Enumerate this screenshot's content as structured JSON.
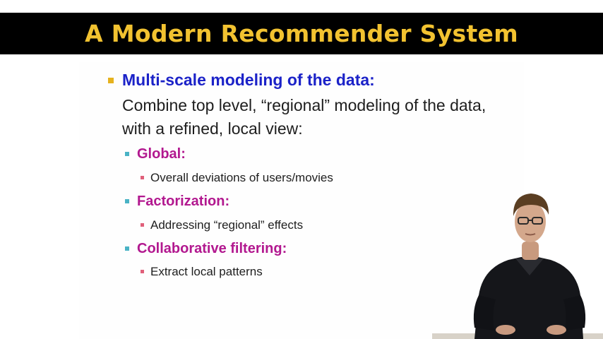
{
  "title": "A Modern Recommender System",
  "main_point": {
    "heading": "Multi-scale modeling of the data:",
    "body": "Combine top level, “regional” modeling of the data, with a refined, local view:"
  },
  "sub_points": [
    {
      "heading": "Global:",
      "detail": "Overall deviations of users/movies"
    },
    {
      "heading": "Factorization:",
      "detail": "Addressing “regional” effects"
    },
    {
      "heading": "Collaborative filtering:",
      "detail": "Extract local patterns"
    }
  ],
  "colors": {
    "title": "#f2c230",
    "heading": "#1b22c8",
    "subheading": "#b2188f",
    "bullet_main": "#e6b21e",
    "bullet_sub": "#4ab3c5",
    "bullet_detail": "#e0607a"
  }
}
